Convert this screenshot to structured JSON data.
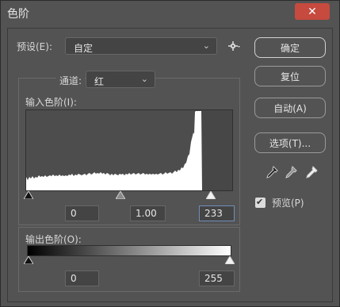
{
  "window": {
    "title": "色阶",
    "close_icon": "close-icon"
  },
  "preset": {
    "label": "预设(E):",
    "value": "自定",
    "gear_icon": "gear-icon"
  },
  "channel": {
    "label": "通道:",
    "value": "红"
  },
  "input_levels": {
    "label": "输入色阶(I):",
    "black": "0",
    "gamma": "1.00",
    "white": "233",
    "black_point_value": 0,
    "gamma_value": 1.0,
    "white_point_value": 233
  },
  "output_levels": {
    "label": "输出色阶(O):",
    "black": "0",
    "white": "255",
    "black_point_value": 0,
    "white_point_value": 255
  },
  "buttons": {
    "ok": "确定",
    "reset": "复位",
    "auto": "自动(A)",
    "options": "选项(T)..."
  },
  "preview": {
    "label": "预览(P)",
    "checked": true
  },
  "eyedroppers": [
    "black-eyedropper-icon",
    "gray-eyedropper-icon",
    "white-eyedropper-icon"
  ],
  "colors": {
    "bg": "#535353",
    "close_red": "#c64a3e",
    "histogram_fill": "#ffffff"
  }
}
